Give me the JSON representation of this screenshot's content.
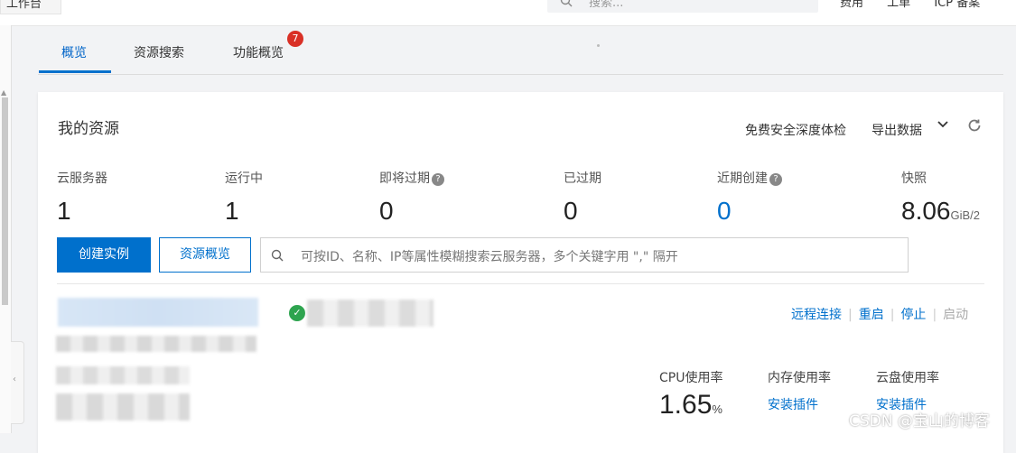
{
  "header": {
    "workspace_label": "工作台",
    "search_placeholder": "搜索...",
    "right_items": [
      "费用",
      "工单",
      "ICP 备案"
    ]
  },
  "tabs": [
    {
      "label": "概览",
      "active": true
    },
    {
      "label": "资源搜索",
      "active": false
    },
    {
      "label": "功能概览",
      "active": false,
      "badge": "7"
    }
  ],
  "card": {
    "title": "我的资源",
    "free_check": "免费安全深度体检",
    "export": "导出数据",
    "stats": [
      {
        "label": "云服务器",
        "value": "1"
      },
      {
        "label": "运行中",
        "value": "1"
      },
      {
        "label": "即将过期",
        "value": "0",
        "help": true
      },
      {
        "label": "已过期",
        "value": "0"
      },
      {
        "label": "近期创建",
        "value": "0",
        "help": true
      },
      {
        "label": "快照",
        "value": "8.06",
        "unit": "GiB/2"
      }
    ],
    "create_button": "创建实例",
    "overview_button": "资源概览",
    "search_placeholder": "可按ID、名称、IP等属性模糊搜索云服务器，多个关键字用 \",\" 隔开"
  },
  "instance": {
    "actions": [
      "远程连接",
      "重启",
      "停止",
      "启动"
    ],
    "metrics": {
      "cpu_label": "CPU使用率",
      "cpu_value": "1.65",
      "cpu_unit": "%",
      "mem_label": "内存使用率",
      "mem_link": "安装插件",
      "disk_label": "云盘使用率",
      "disk_link": "安装插件"
    }
  },
  "watermark": "CSDN @宝山的博客",
  "colors": {
    "accent": "#0070cc",
    "badge": "#d93026",
    "ok": "#2ea44f"
  }
}
